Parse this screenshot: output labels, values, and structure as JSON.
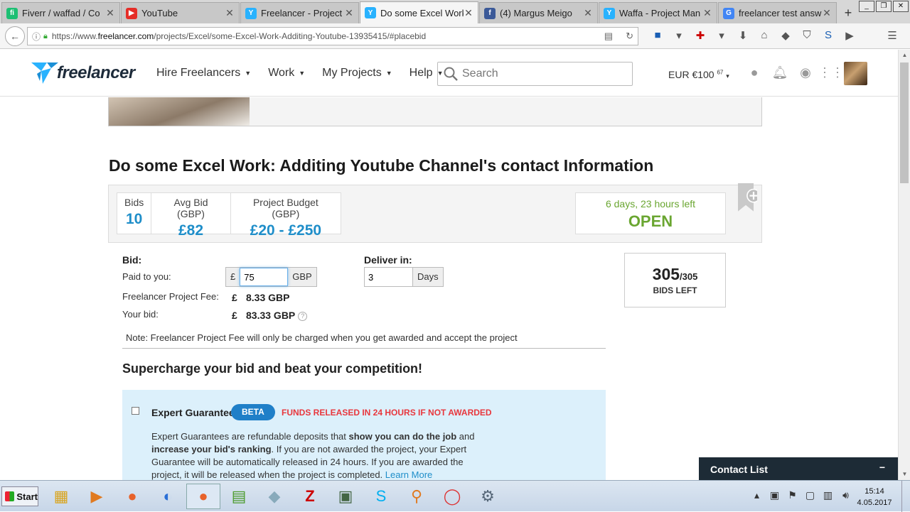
{
  "browser": {
    "tabs": [
      {
        "label": "Fiverr / waffad / Co",
        "icon_color": "#1dbf73",
        "icon_char": "fi"
      },
      {
        "label": "YouTube",
        "icon_color": "#e52d27",
        "icon_char": "▶"
      },
      {
        "label": "Freelancer - Project",
        "icon_color": "#29b2fe",
        "icon_char": "Y"
      },
      {
        "label": "Do some Excel Work",
        "icon_color": "#29b2fe",
        "icon_char": "Y"
      },
      {
        "label": "(4) Margus Meigo",
        "icon_color": "#3b5998",
        "icon_char": "f"
      },
      {
        "label": "Waffa - Project Man",
        "icon_color": "#29b2fe",
        "icon_char": "Y"
      },
      {
        "label": "freelancer test answ",
        "icon_color": "#4285f4",
        "icon_char": "G"
      }
    ],
    "new_tab": "+",
    "url_prefix": "https://www.",
    "url_domain": "freelancer.com",
    "url_path": "/projects/Excel/some-Excel-Work-Additing-Youtube-13935415/#placebid"
  },
  "header": {
    "logo_text": "freelancer",
    "nav": [
      {
        "label": "Hire Freelancers"
      },
      {
        "label": "Work"
      },
      {
        "label": "My Projects"
      },
      {
        "label": "Help"
      }
    ],
    "search_placeholder": "Search",
    "balance": "EUR €100",
    "balance_cents": "67"
  },
  "project": {
    "title": "Do some Excel Work: Additing Youtube Channel's contact Information",
    "stats": [
      {
        "label": "Bids",
        "value": "10"
      },
      {
        "label": "Avg Bid (GBP)",
        "value": "£82"
      },
      {
        "label": "Project Budget (GBP)",
        "value": "£20 - £250"
      }
    ],
    "time_left": "6 days, 23 hours left",
    "status": "OPEN"
  },
  "bid": {
    "bid_label": "Bid:",
    "paid_label": "Paid to you:",
    "currency_symbol": "£",
    "amount": "75",
    "currency_code": "GBP",
    "deliver_label": "Deliver in:",
    "deliver_value": "3",
    "deliver_unit": "Days",
    "fee_label": "Freelancer Project Fee:",
    "fee_value": "8.33 GBP",
    "your_bid_label": "Your bid:",
    "your_bid_value": "83.33 GBP",
    "note": "Note: Freelancer Project Fee will only be charged when you get awarded and accept the project"
  },
  "bids_left": {
    "count": "305",
    "total": "/305",
    "label": "BIDS LEFT"
  },
  "upgrades": {
    "heading": "Supercharge your bid and beat your competition!",
    "expert": {
      "name": "Expert Guarantee",
      "badge": "BETA",
      "promo": "FUNDS RELEASED IN 24 HOURS IF NOT AWARDED",
      "desc_1": "Expert Guarantees are refundable deposits that ",
      "desc_b1": "show you can do the job",
      "desc_2": " and ",
      "desc_b2": "increase your bid's ranking",
      "desc_3": ". If you are not awarded the project, your Expert Guarantee will be automatically released in 24 hours. If you are awarded the project, it will be released when the project is completed. ",
      "learn_more": "Learn More"
    }
  },
  "contact_list": {
    "label": "Contact List",
    "minimize": "−"
  },
  "taskbar": {
    "start": "Start",
    "time": "15:14",
    "date": "4.05.2017"
  }
}
